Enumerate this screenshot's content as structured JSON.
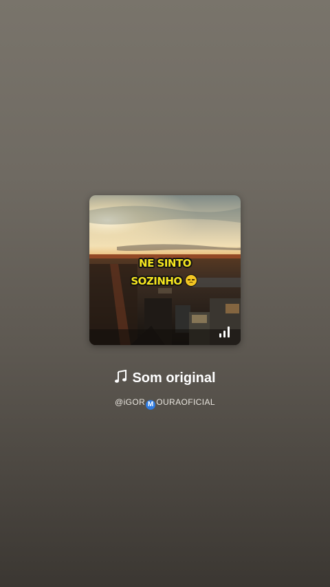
{
  "cover": {
    "overlay_line1": "NE SINTO",
    "overlay_line2": "SOZINHO",
    "emoji": "disappointed-face",
    "playing_indicator": "equalizer-bars-icon",
    "text_color": "#f5e51f"
  },
  "sound": {
    "title": "Som original",
    "title_icon": "music-note-icon",
    "author_prefix": "@iGOR",
    "author_badge": "M",
    "author_suffix": "OURAOFICIAL"
  }
}
